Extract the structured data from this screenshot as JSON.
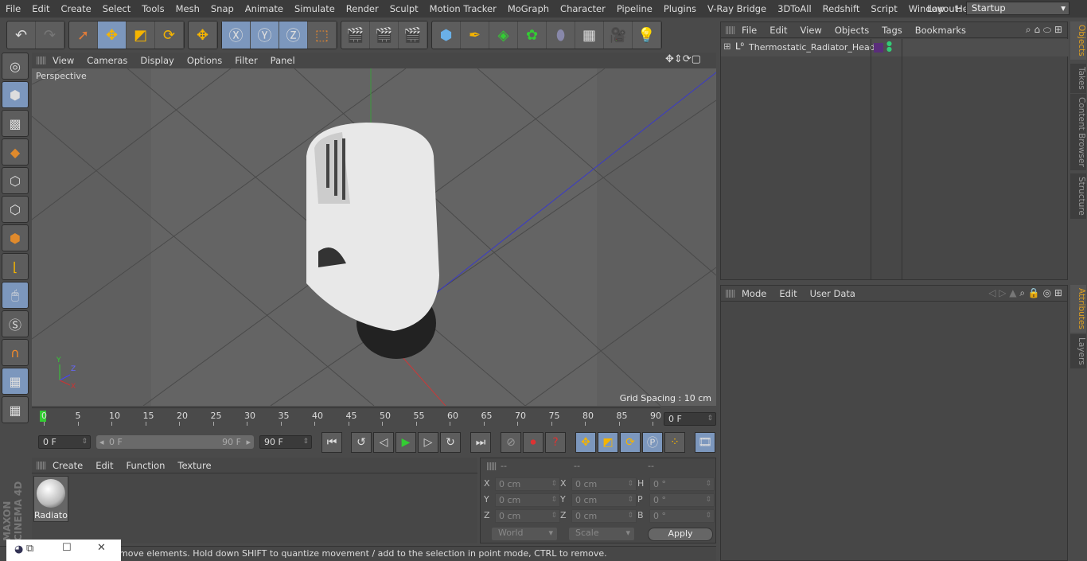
{
  "menu": [
    "File",
    "Edit",
    "Create",
    "Select",
    "Tools",
    "Mesh",
    "Snap",
    "Animate",
    "Simulate",
    "Render",
    "Sculpt",
    "Motion Tracker",
    "MoGraph",
    "Character",
    "Pipeline",
    "Plugins",
    "V-Ray Bridge",
    "3DToAll",
    "Redshift",
    "Script",
    "Window",
    "Help"
  ],
  "layout": {
    "label": "Layout:",
    "value": "Startup"
  },
  "viewport": {
    "menu": [
      "View",
      "Cameras",
      "Display",
      "Options",
      "Filter",
      "Panel"
    ],
    "camera": "Perspective",
    "grid_spacing": "Grid Spacing : 10 cm",
    "axis": {
      "y": "Y",
      "z": "Z",
      "x": "X"
    }
  },
  "timeline": {
    "ticks": [
      "0",
      "5",
      "10",
      "15",
      "20",
      "25",
      "30",
      "35",
      "40",
      "45",
      "50",
      "55",
      "60",
      "65",
      "70",
      "75",
      "80",
      "85",
      "90"
    ],
    "current_frame": "0 F",
    "start": "0 F",
    "range_start": "0 F",
    "range_end": "90 F",
    "end": "90 F"
  },
  "materials": {
    "menu": [
      "Create",
      "Edit",
      "Function",
      "Texture"
    ],
    "items": [
      {
        "name": "Radiato"
      }
    ]
  },
  "coordinates": {
    "headers": [
      "--",
      "--",
      "--"
    ],
    "rows": [
      {
        "l1": "X",
        "v1": "0 cm",
        "l2": "X",
        "v2": "0 cm",
        "l3": "H",
        "v3": "0 °"
      },
      {
        "l1": "Y",
        "v1": "0 cm",
        "l2": "Y",
        "v2": "0 cm",
        "l3": "P",
        "v3": "0 °"
      },
      {
        "l1": "Z",
        "v1": "0 cm",
        "l2": "Z",
        "v2": "0 cm",
        "l3": "B",
        "v3": "0 °"
      }
    ],
    "world": "World",
    "scale": "Scale",
    "apply": "Apply"
  },
  "status": "move elements. Hold down SHIFT to quantize movement / add to the selection in point mode, CTRL to remove.",
  "objects": {
    "menu": [
      "File",
      "Edit",
      "View",
      "Objects",
      "Tags",
      "Bookmarks"
    ],
    "items": [
      {
        "name": "Thermostatic_Radiator_Head",
        "tag_color": "#5a2d7a"
      }
    ]
  },
  "attributes": {
    "menu": [
      "Mode",
      "Edit",
      "User Data"
    ]
  },
  "right_tabs": [
    "Objects",
    "Takes",
    "Content Browser",
    "Structure",
    "Attributes",
    "Layers"
  ],
  "brand": "MAXON CINEMA 4D",
  "colors": {
    "accent": "#7c97bd",
    "active_tab": "#e0a020"
  }
}
